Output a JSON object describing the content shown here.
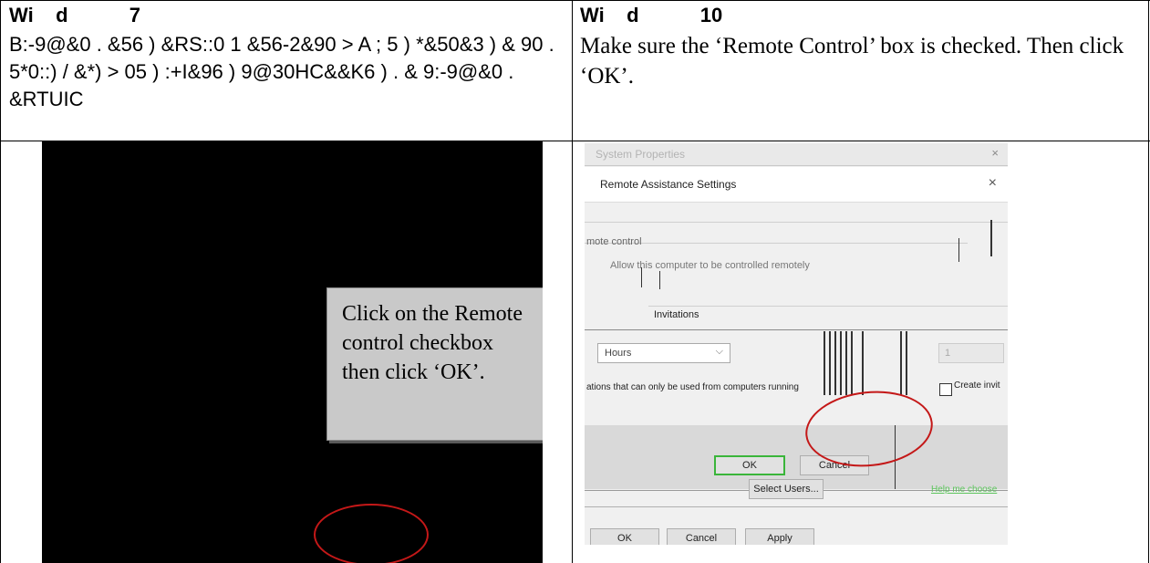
{
  "table": {
    "col1_header": "Wi    d           7",
    "col2_header": "Wi    d           10",
    "col1_instruction": "B:-9@&0 . &56 ) &RS::0 1 &56-2&90 > A ; 5 ) *&50&3 ) & 90 . 5*0::) / &*) > 05 ) :+I&96 ) 9@30HC&&K6 ) . & 9:-9@&0 . &RTUIC",
    "col2_instruction": "Make sure the ‘Remote Control’ box is checked. Then click ‘OK’."
  },
  "left_screenshot": {
    "callout_text": "Click on the Remote control checkbox then click ‘OK’."
  },
  "right_screenshot": {
    "system_title": "System Properties",
    "dialog_title": "Remote Assistance Settings",
    "close_glyph": "×",
    "section_remote_control": "mote control",
    "allow_control_label": "Allow this computer to be controlled remotely",
    "invitations_label": "Invitations",
    "duration_unit": "Hours",
    "duration_value": "1",
    "invitations_note": "ations that can only be used from computers running",
    "create_invitation_label": "Create invit",
    "ok_label": "OK",
    "cancel_label": "Cancel",
    "select_users_label": "Select Users...",
    "help_link": "Help me choose",
    "bottom_ok": "OK",
    "bottom_cancel": "Cancel",
    "bottom_apply": "Apply",
    "accent_color": "#3ab53a",
    "highlight_color": "#c41818"
  }
}
